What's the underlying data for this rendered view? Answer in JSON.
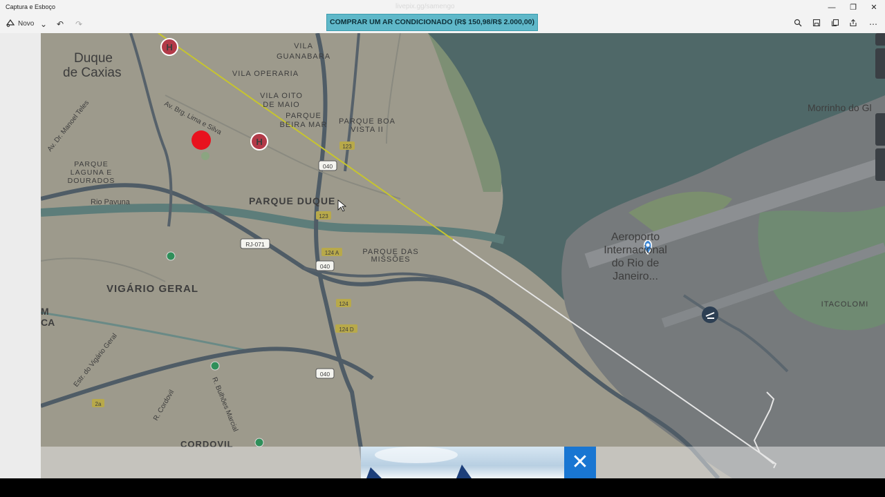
{
  "window": {
    "app_title": "Captura e Esboço",
    "faded_url": "livepix.gg/samengo",
    "controls": {
      "minimize": "—",
      "restore": "❐",
      "close": "✕"
    }
  },
  "toolbar": {
    "new_label": "Novo",
    "new_icon": "snip-icon",
    "chevron": "⌄",
    "undo": "↶",
    "redo": "↷",
    "right_icons": [
      "zoom-icon",
      "save-icon",
      "copy-icon",
      "share-icon",
      "more-icon"
    ],
    "more": "⋯"
  },
  "banner": {
    "text": "COMPRAR UM AR CONDICIONADO (R$ 150,98/R$ 2.000,00)"
  },
  "map": {
    "labels": {
      "duque": "Duque",
      "de_caxias": "de Caxias",
      "vila_guanabara_1": "VILA",
      "vila_guanabara_2": "GUANABARA",
      "vila_operaria": "VILA OPERARIA",
      "vila_oito_1": "VILA OITO",
      "vila_oito_2": "DE MAIO",
      "parque_beira_1": "PARQUE",
      "parque_beira_2": "BEIRA MAR",
      "parque_boa_1": "PARQUE BOA",
      "parque_boa_2": "VISTA II",
      "av_brg": "Av. Brg. Lima e Silva",
      "av_dr_manoel": "Av. Dr. Manoel Teles",
      "parque_laguna_1": "PARQUE",
      "parque_laguna_2": "LAGUNA E",
      "parque_laguna_3": "DOURADOS",
      "rio_pavuna": "Rio Pavuna",
      "parque_duque": "PARQUE DUQUE",
      "parque_missoes_1": "PARQUE DAS",
      "parque_missoes_2": "MISSÕES",
      "vigario_geral": "VIGÁRIO GERAL",
      "m": "M",
      "ca": "CA",
      "estr_vigario": "Estr. do Vigário Geral",
      "r_cordovil": "R. Cordovil",
      "r_bulhoes": "R. Bulhões Marcial",
      "cordovil": "CORDOVIL",
      "aeroporto_1": "Aeroporto",
      "aeroporto_2": "Internacional",
      "aeroporto_3": "do Rio de",
      "aeroporto_4": "Janeiro...",
      "itacolomi": "ITACOLOMI",
      "morrinho": "Morrinho do Gl"
    },
    "shields": {
      "r123a": "123",
      "r040a": "040",
      "r123b": "123",
      "rj071": "RJ-071",
      "r124a": "124 A",
      "r040b": "040",
      "r124": "124",
      "r124d": "124 D",
      "r040c": "040",
      "r2a": "2a"
    },
    "hospital_symbol": "H",
    "icons": [
      "hospital-icon",
      "airport-icon",
      "location-pin-icon",
      "green-poi-icon"
    ],
    "colors": {
      "land": "#9e9d8f",
      "water": "#4e6a6a",
      "road": "#4f5c66",
      "route_past": "#c8c832",
      "route_future": "#e8e8e8",
      "marker": "#e8121e",
      "hospital": "#b23a48"
    }
  },
  "ad": {
    "close_symbol": "✕"
  }
}
